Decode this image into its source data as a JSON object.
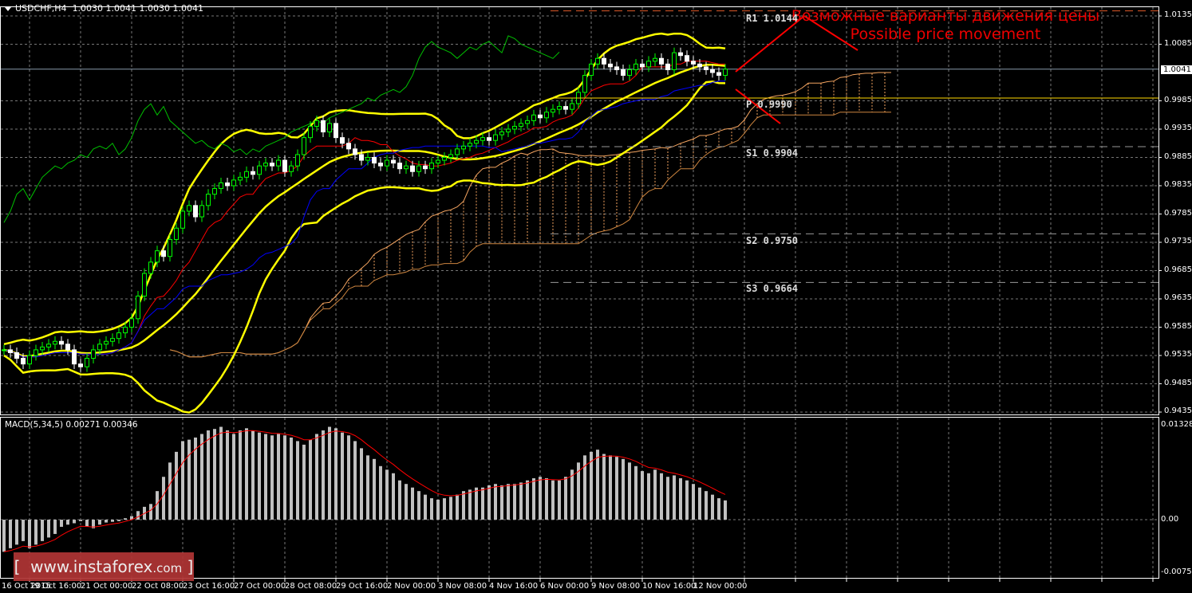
{
  "header": {
    "symbol": "USDCHF,H4",
    "ohlc": "1.0030 1.0041 1.0030 1.0041"
  },
  "current_price": "1.0041",
  "price_axis": [
    "1.0135",
    "1.0085",
    "0.9985",
    "0.9935",
    "0.9885",
    "0.9835",
    "0.9785",
    "0.9735",
    "0.9685",
    "0.9635",
    "0.9585",
    "0.9535",
    "0.9485",
    "0.9435"
  ],
  "macd_axis": [
    "0.01328",
    "0.00",
    "-0.00751"
  ],
  "time_axis": [
    "16 Oct 2015",
    "19 Oct 16:00",
    "21 Oct 00:00",
    "22 Oct 08:00",
    "23 Oct 16:00",
    "27 Oct 00:00",
    "28 Oct 08:00",
    "29 Oct 16:00",
    "2 Nov 00:00",
    "3 Nov 08:00",
    "4 Nov 16:00",
    "6 Nov 00:00",
    "9 Nov 08:00",
    "10 Nov 16:00",
    "12 Nov 00:00"
  ],
  "pivots": [
    {
      "label": "R1 1.0144",
      "value": 1.0144,
      "color": "#e05a2a",
      "style": "dashed"
    },
    {
      "label": "P 0.9990",
      "value": 0.999,
      "color": "#ffd700",
      "style": "solid"
    },
    {
      "label": "S1 0.9904",
      "value": 0.9904,
      "color": "#999999",
      "style": "dashed"
    },
    {
      "label": "S2 0.9750",
      "value": 0.975,
      "color": "#999999",
      "style": "dashed"
    },
    {
      "label": "S3 0.9664",
      "value": 0.9664,
      "color": "#999999",
      "style": "dashed"
    }
  ],
  "annotation": {
    "line1": "Возможные варианты движения цены",
    "line2": "Possible price movement",
    "color": "#ff0000"
  },
  "macd_label": "MACD(5,34,5) 0.00271 0.00346",
  "watermark": {
    "left": "[",
    "site": "www.instaforex",
    "tld": ".com",
    "right": "]"
  },
  "chart_data": {
    "type": "candlestick",
    "ylim": [
      0.9435,
      1.0135
    ],
    "closes": [
      0.9545,
      0.954,
      0.953,
      0.952,
      0.9535,
      0.9545,
      0.955,
      0.9555,
      0.956,
      0.9555,
      0.9545,
      0.952,
      0.9515,
      0.953,
      0.9545,
      0.9555,
      0.956,
      0.9565,
      0.9575,
      0.9585,
      0.96,
      0.964,
      0.968,
      0.97,
      0.972,
      0.971,
      0.974,
      0.976,
      0.979,
      0.98,
      0.978,
      0.98,
      0.982,
      0.983,
      0.984,
      0.9835,
      0.9845,
      0.985,
      0.986,
      0.9855,
      0.987,
      0.9875,
      0.987,
      0.988,
      0.986,
      0.987,
      0.989,
      0.992,
      0.994,
      0.995,
      0.993,
      0.9945,
      0.992,
      0.991,
      0.99,
      0.989,
      0.988,
      0.9885,
      0.9875,
      0.987,
      0.988,
      0.9875,
      0.9865,
      0.987,
      0.986,
      0.987,
      0.9865,
      0.9875,
      0.988,
      0.9885,
      0.989,
      0.99,
      0.9905,
      0.991,
      0.9915,
      0.992,
      0.9915,
      0.9925,
      0.993,
      0.9935,
      0.994,
      0.9945,
      0.995,
      0.996,
      0.9955,
      0.9965,
      0.997,
      0.9975,
      0.997,
      0.998,
      1.0,
      1.003,
      1.005,
      1.006,
      1.005,
      1.0045,
      1.004,
      1.003,
      1.004,
      1.005,
      1.0045,
      1.0055,
      1.006,
      1.005,
      1.004,
      1.007,
      1.0065,
      1.0055,
      1.005,
      1.0045,
      1.004,
      1.0035,
      1.003,
      1.0041
    ],
    "macd": {
      "ylim": [
        -0.00751,
        0.01328
      ],
      "histogram": [
        -0.0045,
        -0.004,
        -0.0035,
        -0.003,
        -0.004,
        -0.0035,
        -0.003,
        -0.0025,
        -0.002,
        -0.001,
        -0.0007,
        -0.0005,
        -0.0002,
        -0.001,
        -0.0012,
        -0.0007,
        -0.0004,
        -0.0003,
        -0.0002,
        0.0002,
        0.0005,
        0.0012,
        0.0018,
        0.0022,
        0.004,
        0.006,
        0.008,
        0.0095,
        0.011,
        0.0112,
        0.0115,
        0.012,
        0.0125,
        0.0127,
        0.013,
        0.0125,
        0.012,
        0.0125,
        0.0128,
        0.0125,
        0.0122,
        0.012,
        0.0118,
        0.012,
        0.0118,
        0.0115,
        0.011,
        0.0105,
        0.0112,
        0.012,
        0.0125,
        0.013,
        0.0128,
        0.0122,
        0.0118,
        0.011,
        0.01,
        0.009,
        0.0085,
        0.0075,
        0.007,
        0.0065,
        0.0055,
        0.005,
        0.0045,
        0.004,
        0.0035,
        0.003,
        0.0028,
        0.003,
        0.0032,
        0.0035,
        0.004,
        0.0042,
        0.0045,
        0.0045,
        0.0048,
        0.005,
        0.0048,
        0.005,
        0.005,
        0.0052,
        0.0055,
        0.0058,
        0.006,
        0.0058,
        0.0055,
        0.0055,
        0.006,
        0.007,
        0.008,
        0.009,
        0.0095,
        0.0098,
        0.0092,
        0.009,
        0.0088,
        0.0085,
        0.008,
        0.0075,
        0.0068,
        0.0065,
        0.007,
        0.0065,
        0.006,
        0.0062,
        0.0058,
        0.0055,
        0.005,
        0.0045,
        0.004,
        0.0035,
        0.003,
        0.0027
      ]
    },
    "colors": {
      "bull": "#00ff00",
      "bear": "#ffffff",
      "bollinger": "#ffff00",
      "tenkan": "#ff0000",
      "kijun": "#0000ff",
      "chikou": "#00c000",
      "cloud": "#f4a460",
      "macd_bar": "#c0c0c0",
      "macd_signal": "#ff0000"
    }
  }
}
